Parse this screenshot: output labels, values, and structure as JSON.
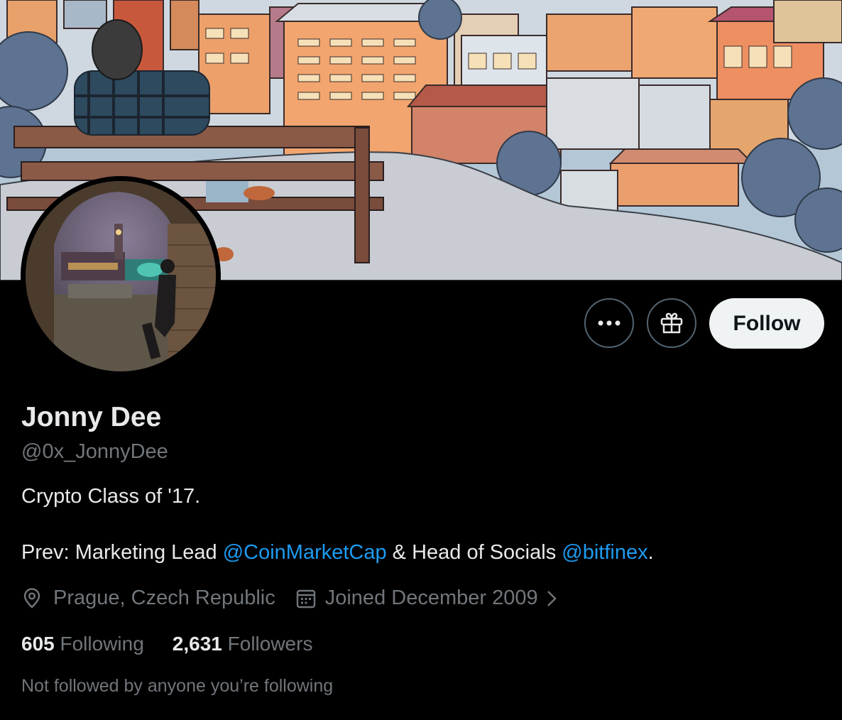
{
  "profile": {
    "name": "Jonny Dee",
    "handle": "@0x_JonnyDee",
    "bio_line1": "Crypto Class of '17.",
    "bio_prefix": "Prev: Marketing Lead ",
    "mention1": "@CoinMarketCap",
    "bio_middle": " & Head of Socials ",
    "mention2": "@bitfinex",
    "bio_suffix": ".",
    "location": "Prague, Czech Republic",
    "joined": "Joined December 2009",
    "following_count": "605",
    "following_label": "Following",
    "followers_count": "2,631",
    "followers_label": "Followers",
    "not_followed": "Not followed by anyone you’re following"
  },
  "actions": {
    "follow_label": "Follow",
    "more_icon": "more-horizontal-icon",
    "gift_icon": "gift-icon"
  },
  "colors": {
    "background": "#000000",
    "primary_text": "#e7e9ea",
    "secondary_text": "#71767b",
    "link": "#1d9bf0",
    "follow_button": "#eff3f4",
    "button_border": "#536471"
  }
}
